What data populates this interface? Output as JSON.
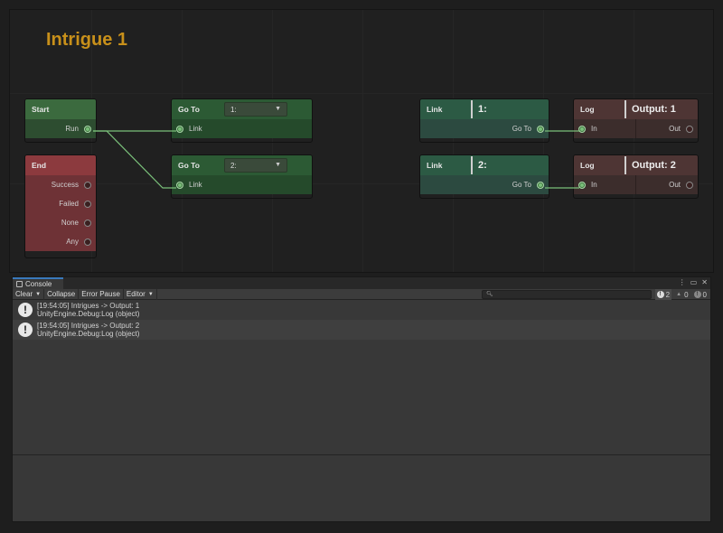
{
  "graph": {
    "title": "Intrigue 1",
    "nodes": {
      "start": {
        "title": "Start",
        "ports": [
          "Run"
        ]
      },
      "end": {
        "title": "End",
        "ports": [
          "Success",
          "Failed",
          "None",
          "Any"
        ]
      },
      "goto1": {
        "title": "Go To",
        "dropdown": "1:",
        "port": "Link"
      },
      "goto2": {
        "title": "Go To",
        "dropdown": "2:",
        "port": "Link"
      },
      "link1": {
        "title": "Link",
        "field": "1:",
        "port": "Go To"
      },
      "link2": {
        "title": "Link",
        "field": "2:",
        "port": "Go To"
      },
      "log1": {
        "title": "Log",
        "field": "Output: 1",
        "in": "In",
        "out": "Out"
      },
      "log2": {
        "title": "Log",
        "field": "Output: 2",
        "in": "In",
        "out": "Out"
      }
    },
    "colors": {
      "wire": "#7ac07a",
      "title": "#c8901a"
    }
  },
  "console": {
    "tab_label": "Console",
    "toolbar": {
      "clear": "Clear",
      "collapse": "Collapse",
      "error_pause": "Error Pause",
      "editor": "Editor"
    },
    "counts": {
      "info": "2",
      "warnings": "0",
      "errors": "0"
    },
    "entries": [
      {
        "line1": "[19:54:05] Intrigues -> Output: 1",
        "line2": "UnityEngine.Debug:Log (object)"
      },
      {
        "line1": "[19:54:05] Intrigues -> Output: 2",
        "line2": "UnityEngine.Debug:Log (object)"
      }
    ]
  }
}
